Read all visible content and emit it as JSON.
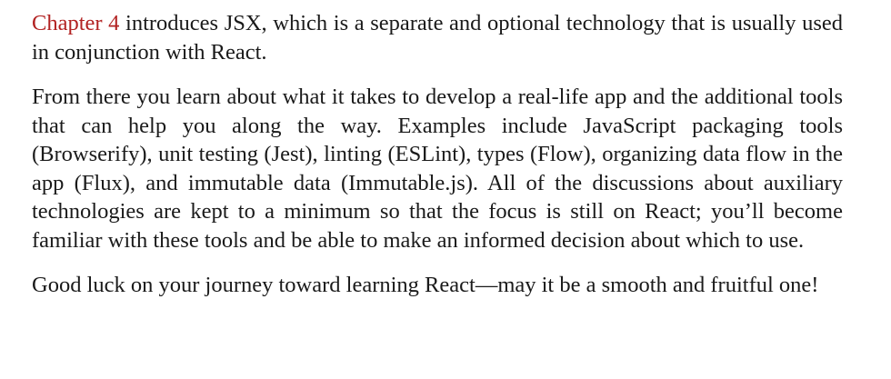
{
  "document": {
    "paragraphs": [
      {
        "link_text": "Chapter 4",
        "text": " introduces JSX, which is a separate and optional technology that is usually used in conjunction with React."
      },
      {
        "text": "From there you learn about what it takes to develop a real-life app and the additional tools that can help you along the way. Examples include JavaScript packaging tools (Browserify), unit testing (Jest), linting (ESLint), types (Flow), organizing data flow in the app (Flux), and immutable data (Immutable.js). All of the discussions about aux­iliary technologies are kept to a minimum so that the focus is still on React; you’ll become familiar with these tools and be able to make an informed decision about which to use."
      },
      {
        "text": "Good luck on your journey toward learning React—may it be a smooth and fruitful one!"
      }
    ]
  },
  "colors": {
    "link": "#b22222",
    "text": "#1a1a1a",
    "background": "#ffffff"
  }
}
